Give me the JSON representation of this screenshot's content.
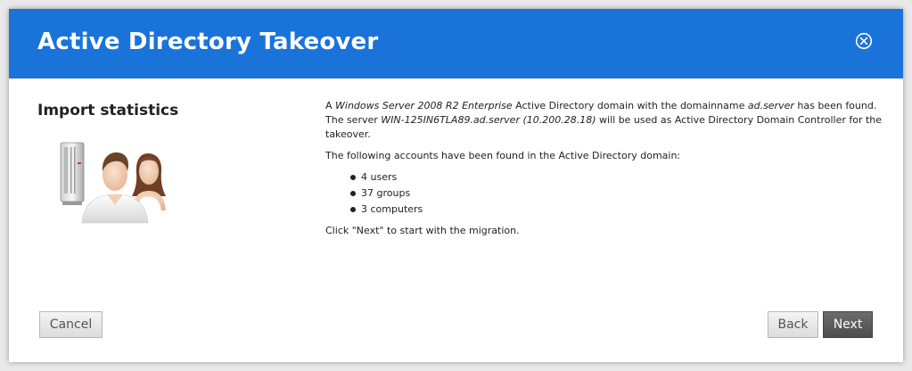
{
  "dialog": {
    "title": "Active Directory Takeover",
    "close_icon": "close-circle-icon",
    "accent_color": "#1a73d9"
  },
  "left": {
    "heading": "Import statistics",
    "illustration_icon": "server-users-icon"
  },
  "content": {
    "p1_a": "A ",
    "p1_os": "Windows Server 2008 R2 Enterprise",
    "p1_b": " Active Directory domain with the domainname ",
    "p1_domain": "ad.server",
    "p1_c": " has been found.",
    "p1_d": "The server ",
    "p1_server": "WIN-125IN6TLA89.ad.server (10.200.28.18)",
    "p1_e": " will be used as Active Directory Domain Controller for the takeover.",
    "p2": "The following accounts have been found in the Active Directory domain:",
    "accounts": [
      "4 users",
      "37 groups",
      "3 computers"
    ],
    "p3": "Click \"Next\" to start with the migration."
  },
  "buttons": {
    "cancel": "Cancel",
    "back": "Back",
    "next": "Next"
  }
}
